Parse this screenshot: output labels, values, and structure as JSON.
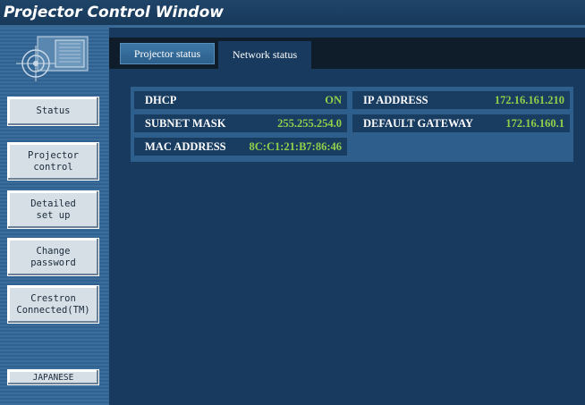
{
  "window": {
    "title": "Projector Control Window"
  },
  "sidebar": {
    "items": [
      {
        "label": "Status"
      },
      {
        "label": "Projector\ncontrol"
      },
      {
        "label": "Detailed\nset up"
      },
      {
        "label": "Change\npassword"
      },
      {
        "label": "Crestron\nConnected(TM)"
      },
      {
        "label": "JAPANESE"
      }
    ]
  },
  "tabs": [
    {
      "label": "Projector status",
      "active": false
    },
    {
      "label": "Network status",
      "active": true
    }
  ],
  "network": {
    "dhcp": {
      "label": "DHCP",
      "value": "ON"
    },
    "ip_address": {
      "label": "IP ADDRESS",
      "value": "172.16.161.210"
    },
    "subnet_mask": {
      "label": "SUBNET MASK",
      "value": "255.255.254.0"
    },
    "default_gateway": {
      "label": "DEFAULT GATEWAY",
      "value": "172.16.160.1"
    },
    "mac_address": {
      "label": "MAC ADDRESS",
      "value": "8C:C1:21:B7:86:46"
    }
  },
  "colors": {
    "value_text": "#8fd14a",
    "panel_bg": "#173a5e",
    "sidebar_bg": "#3a6d9c"
  },
  "icons": [
    "projector-logo-icon"
  ]
}
